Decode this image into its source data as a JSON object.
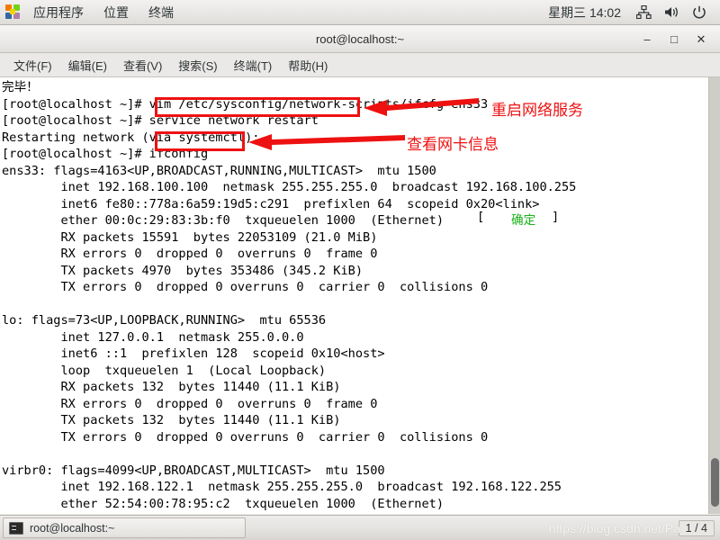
{
  "panel": {
    "apps_icon": "apps-grid-icon",
    "items": [
      "应用程序",
      "位置",
      "终端"
    ],
    "clock": "星期三 14:02",
    "tray": [
      "network-icon",
      "volume-icon",
      "power-icon"
    ]
  },
  "window": {
    "title": "root@localhost:~",
    "buttons": {
      "minimize": "–",
      "maximize": "□",
      "close": "✕"
    },
    "menu": [
      "文件(F)",
      "编辑(E)",
      "查看(V)",
      "搜索(S)",
      "终端(T)",
      "帮助(H)"
    ]
  },
  "terminal": {
    "lines": [
      "完毕！",
      "[root@localhost ~]# vim /etc/sysconfig/network-scripts/ifcfg-ens33",
      "[root@localhost ~]# service network restart",
      "Restarting network (via systemctl):",
      "[root@localhost ~]# ifconfig",
      "ens33: flags=4163<UP,BROADCAST,RUNNING,MULTICAST>  mtu 1500",
      "        inet 192.168.100.100  netmask 255.255.255.0  broadcast 192.168.100.255",
      "        inet6 fe80::778a:6a59:19d5:c291  prefixlen 64  scopeid 0x20<link>",
      "        ether 00:0c:29:83:3b:f0  txqueuelen 1000  (Ethernet)",
      "        RX packets 15591  bytes 22053109 (21.0 MiB)",
      "        RX errors 0  dropped 0  overruns 0  frame 0",
      "        TX packets 4970  bytes 353486 (345.2 KiB)",
      "        TX errors 0  dropped 0 overruns 0  carrier 0  collisions 0",
      "",
      "lo: flags=73<UP,LOOPBACK,RUNNING>  mtu 65536",
      "        inet 127.0.0.1  netmask 255.0.0.0",
      "        inet6 ::1  prefixlen 128  scopeid 0x10<host>",
      "        loop  txqueuelen 1  (Local Loopback)",
      "        RX packets 132  bytes 11440 (11.1 KiB)",
      "        RX errors 0  dropped 0  overruns 0  frame 0",
      "        TX packets 132  bytes 11440 (11.1 KiB)",
      "        TX errors 0  dropped 0 overruns 0  carrier 0  collisions 0",
      "",
      "virbr0: flags=4099<UP,BROADCAST,MULTICAST>  mtu 1500",
      "        inet 192.168.122.1  netmask 255.255.255.0  broadcast 192.168.122.255",
      "        ether 52:54:00:78:95:c2  txqueuelen 1000  (Ethernet)"
    ],
    "status_bracket_left": "[",
    "status_ok": "确定",
    "status_bracket_right": "]"
  },
  "annotations": {
    "color": "#ee1111",
    "ok_color": "#18b018",
    "box1_label": "service network restart",
    "box2_label": "ifconfig",
    "note1": "重启网络服务",
    "note2": "查看网卡信息"
  },
  "taskbar": {
    "task_label": "root@localhost:~",
    "task_icon": "terminal-icon",
    "workspace": "1 / 4",
    "watermark": "https://blog.csdn.net/Pa"
  }
}
